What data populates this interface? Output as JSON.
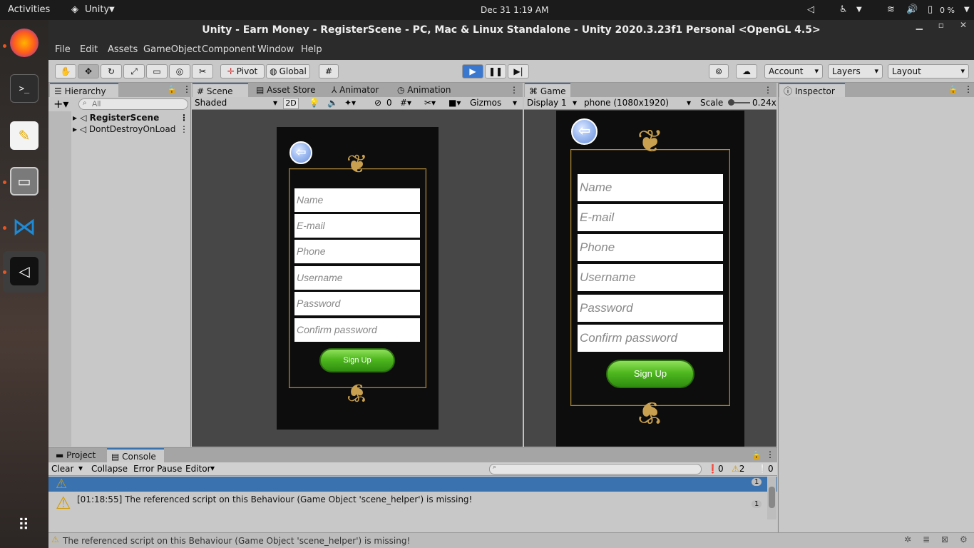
{
  "topbar": {
    "activities": "Activities",
    "app": "Unity",
    "clock": "Dec 31   1:19 AM",
    "battery": "0 %"
  },
  "window": {
    "title": "Unity - Earn Money - RegisterScene - PC, Mac & Linux Standalone - Unity 2020.3.23f1 Personal <OpenGL 4.5>"
  },
  "menu": [
    "File",
    "Edit",
    "Assets",
    "GameObject",
    "Component",
    "Window",
    "Help"
  ],
  "toolbar": {
    "pivot": "Pivot",
    "global": "Global",
    "account": "Account",
    "layers": "Layers",
    "layout": "Layout"
  },
  "hierarchy": {
    "tab": "Hierarchy",
    "search_placeholder": "All",
    "items": [
      "RegisterScene",
      "DontDestroyOnLoad"
    ]
  },
  "scene": {
    "tabs": [
      "Scene",
      "Asset Store",
      "Animator",
      "Animation"
    ],
    "shading": "Shaded",
    "mode2d": "2D",
    "hidden_count": "0",
    "gizmos": "Gizmos"
  },
  "game": {
    "tab": "Game",
    "display": "Display 1",
    "resolution": "phone (1080x1920)",
    "scale_label": "Scale",
    "scale_value": "0.24x"
  },
  "inspector": {
    "tab": "Inspector"
  },
  "form": {
    "fields": [
      "Name",
      "E-mail",
      "Phone",
      "Username",
      "Password",
      "Confirm password"
    ],
    "signup": "Sign Up"
  },
  "console": {
    "tabs": [
      "Project",
      "Console"
    ],
    "clear": "Clear",
    "collapse": "Collapse",
    "error_pause": "Error Pause",
    "editor": "Editor",
    "errors": "0",
    "warnings": "2",
    "messages": "0",
    "rows": [
      {
        "text": "[01:18:55] The referenced script on this Behaviour (Game Object 'scene_helper') is missing!",
        "count": "1"
      }
    ],
    "first_count": "1"
  },
  "status": {
    "text": "The referenced script on this Behaviour (Game Object 'scene_helper') is missing!"
  }
}
